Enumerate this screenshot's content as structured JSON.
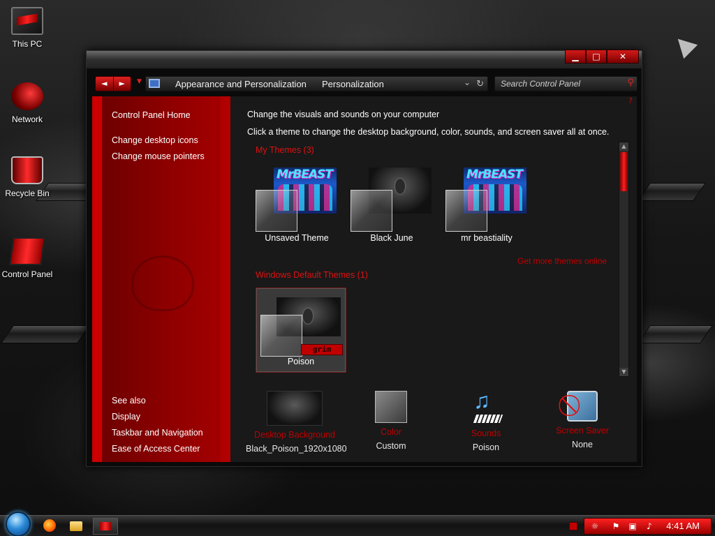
{
  "desktop": {
    "icons": [
      {
        "label": "This PC"
      },
      {
        "label": "Network"
      },
      {
        "label": "Recycle Bin"
      },
      {
        "label": "Control Panel"
      }
    ]
  },
  "window": {
    "controls": {
      "minimize": "▁",
      "maximize": "□",
      "close": "✕"
    },
    "nav": {
      "back": "◄",
      "forward": "►"
    },
    "address": {
      "crumbs": [
        "Appearance and Personalization",
        "Personalization"
      ]
    },
    "search": {
      "placeholder": "Search Control Panel"
    }
  },
  "sidebar": {
    "home": "Control Panel Home",
    "links": [
      "Change desktop icons",
      "Change mouse pointers"
    ],
    "see_also_heading": "See also",
    "see_also": [
      "Display",
      "Taskbar and Navigation",
      "Ease of Access Center"
    ]
  },
  "main": {
    "heading": "Change the visuals and sounds on your computer",
    "subheading": "Click a theme to change the desktop background, color, sounds, and screen saver all at once.",
    "my_themes": {
      "title": "My Themes (3)",
      "items": [
        {
          "label": "Unsaved Theme",
          "style": "mrbeast"
        },
        {
          "label": "Black June",
          "style": "dark"
        },
        {
          "label": "mr beastiality",
          "style": "mrbeast"
        }
      ]
    },
    "get_more": "Get more themes online",
    "default_themes": {
      "title": "Windows Default Themes (1)",
      "items": [
        {
          "label": "Poison",
          "selected": true,
          "badge": "grim"
        }
      ]
    },
    "bottom": [
      {
        "title": "Desktop Background",
        "value": "Black_Poison_1920x1080"
      },
      {
        "title": "Color",
        "value": "Custom"
      },
      {
        "title": "Sounds",
        "value": "Poison"
      },
      {
        "title": "Screen Saver",
        "value": "None"
      }
    ]
  },
  "taskbar": {
    "clock": "4:41 AM",
    "accent": "#c00000"
  }
}
